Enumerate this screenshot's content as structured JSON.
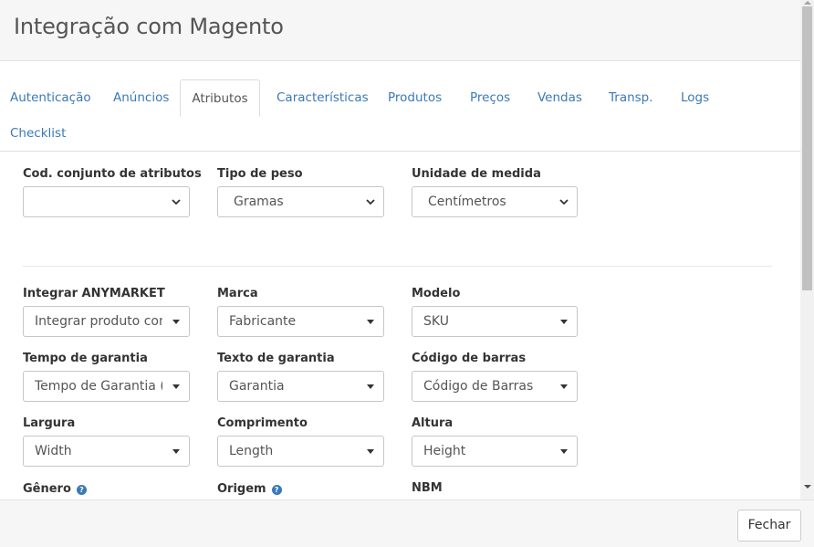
{
  "modal": {
    "title": "Integração com Magento"
  },
  "tabs": [
    {
      "label": "Autenticação"
    },
    {
      "label": "Anúncios"
    },
    {
      "label": "Atributos",
      "active": true
    },
    {
      "label": "Características"
    },
    {
      "label": "Produtos"
    },
    {
      "label": "Preços"
    },
    {
      "label": "Vendas"
    },
    {
      "label": "Transp."
    },
    {
      "label": "Logs"
    },
    {
      "label": "Checklist"
    }
  ],
  "fields": {
    "cod_conjunto": {
      "label": "Cod. conjunto de atributos",
      "value": ""
    },
    "tipo_peso": {
      "label": "Tipo de peso",
      "value": "Gramas"
    },
    "unidade_medida": {
      "label": "Unidade de medida",
      "value": "Centímetros"
    },
    "integrar_anymarket": {
      "label": "Integrar ANYMARKET",
      "value": "Integrar produto com"
    },
    "marca": {
      "label": "Marca",
      "value": "Fabricante"
    },
    "modelo": {
      "label": "Modelo",
      "value": "SKU"
    },
    "tempo_garantia": {
      "label": "Tempo de garantia",
      "value": "Tempo de Garantia (Se"
    },
    "texto_garantia": {
      "label": "Texto de garantia",
      "value": "Garantia"
    },
    "codigo_barras": {
      "label": "Código de barras",
      "value": "Código de Barras"
    },
    "largura": {
      "label": "Largura",
      "value": "Width"
    },
    "comprimento": {
      "label": "Comprimento",
      "value": "Length"
    },
    "altura": {
      "label": "Altura",
      "value": "Height"
    },
    "genero": {
      "label": "Gênero"
    },
    "origem": {
      "label": "Origem"
    },
    "nbm": {
      "label": "NBM"
    }
  },
  "help_icon": {
    "glyph": "?",
    "color": "#3a79b8"
  },
  "footer": {
    "close_label": "Fechar"
  },
  "colors": {
    "link": "#3a79b8",
    "header_bg": "#f5f6f5"
  }
}
